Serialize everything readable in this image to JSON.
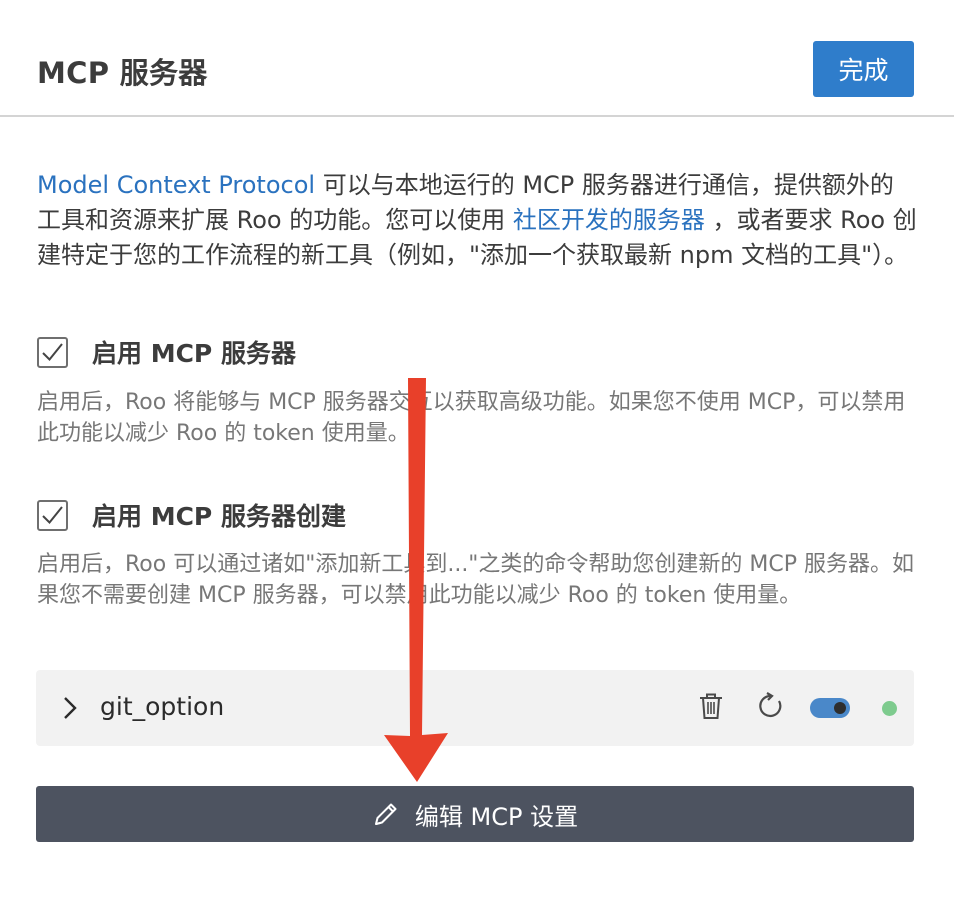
{
  "header": {
    "title": "MCP 服务器",
    "done_label": "完成"
  },
  "intro": {
    "link1": "Model Context Protocol",
    "text1": " 可以与本地运行的 MCP 服务器进行通信，提供额外的工具和资源来扩展 Roo 的功能。您可以使用 ",
    "link2": "社区开发的服务器",
    "text2": " ，或者要求 Roo 创建特定于您的工作流程的新工具（例如，\"添加一个获取最新 npm 文档的工具\"）。"
  },
  "options": [
    {
      "label": "启用 MCP 服务器",
      "checked": true,
      "description": "启用后，Roo 将能够与 MCP 服务器交互以获取高级功能。如果您不使用 MCP，可以禁用此功能以减少 Roo 的 token 使用量。"
    },
    {
      "label": "启用 MCP 服务器创建",
      "checked": true,
      "description": "启用后，Roo 可以通过诸如\"添加新工具到...\"之类的命令帮助您创建新的 MCP 服务器。如果您不需要创建 MCP 服务器，可以禁用此功能以减少 Roo 的 token 使用量。"
    }
  ],
  "servers": [
    {
      "name": "git_option",
      "enabled": true,
      "status_color": "#7ecb8e"
    }
  ],
  "edit_button": {
    "label": "编辑 MCP 设置"
  },
  "colors": {
    "accent": "#2f7dcb",
    "link": "#2a72bf",
    "edit_button_bg": "#4d5360",
    "annotation_arrow": "#e8402a"
  },
  "icons": [
    "checkmark-icon",
    "chevron-right-icon",
    "trash-icon",
    "refresh-icon",
    "toggle-switch",
    "status-dot",
    "pencil-icon"
  ]
}
